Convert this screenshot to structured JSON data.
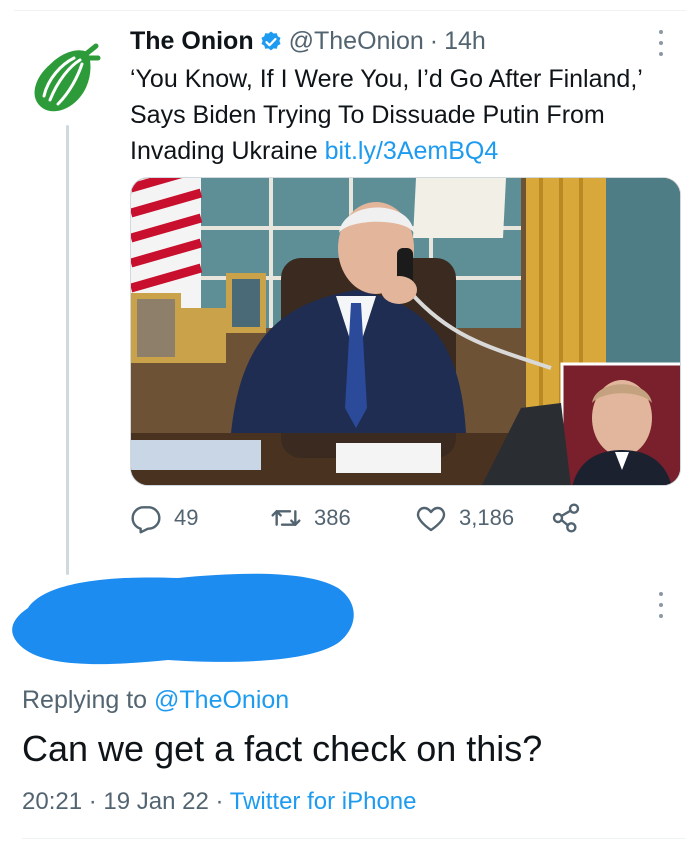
{
  "tweet": {
    "display_name": "The Onion",
    "handle": "@TheOnion",
    "separator": "·",
    "time": "14h",
    "text": "‘You Know, If I Were You, I’d Go After Finland,’ Says Biden Trying To Dissuade Putin From Invading Ukraine",
    "link": "bit.ly/3AemBQ4",
    "metrics": {
      "replies": "49",
      "retweets": "386",
      "likes": "3,186"
    }
  },
  "reply": {
    "replying_label": "Replying to",
    "replying_to": "@TheOnion",
    "text": "Can we get a fact check on this?",
    "time": "20:21",
    "date": "19 Jan 22",
    "separator": "·",
    "source": "Twitter for iPhone"
  },
  "colors": {
    "accent": "#1d9bf0",
    "onion_green": "#2e9b3a",
    "muted": "#536471",
    "redaction": "#1d8cf0"
  },
  "icons": [
    "onion-logo",
    "verified-badge-icon",
    "more-icon",
    "reply-icon",
    "retweet-icon",
    "like-icon",
    "share-icon"
  ]
}
